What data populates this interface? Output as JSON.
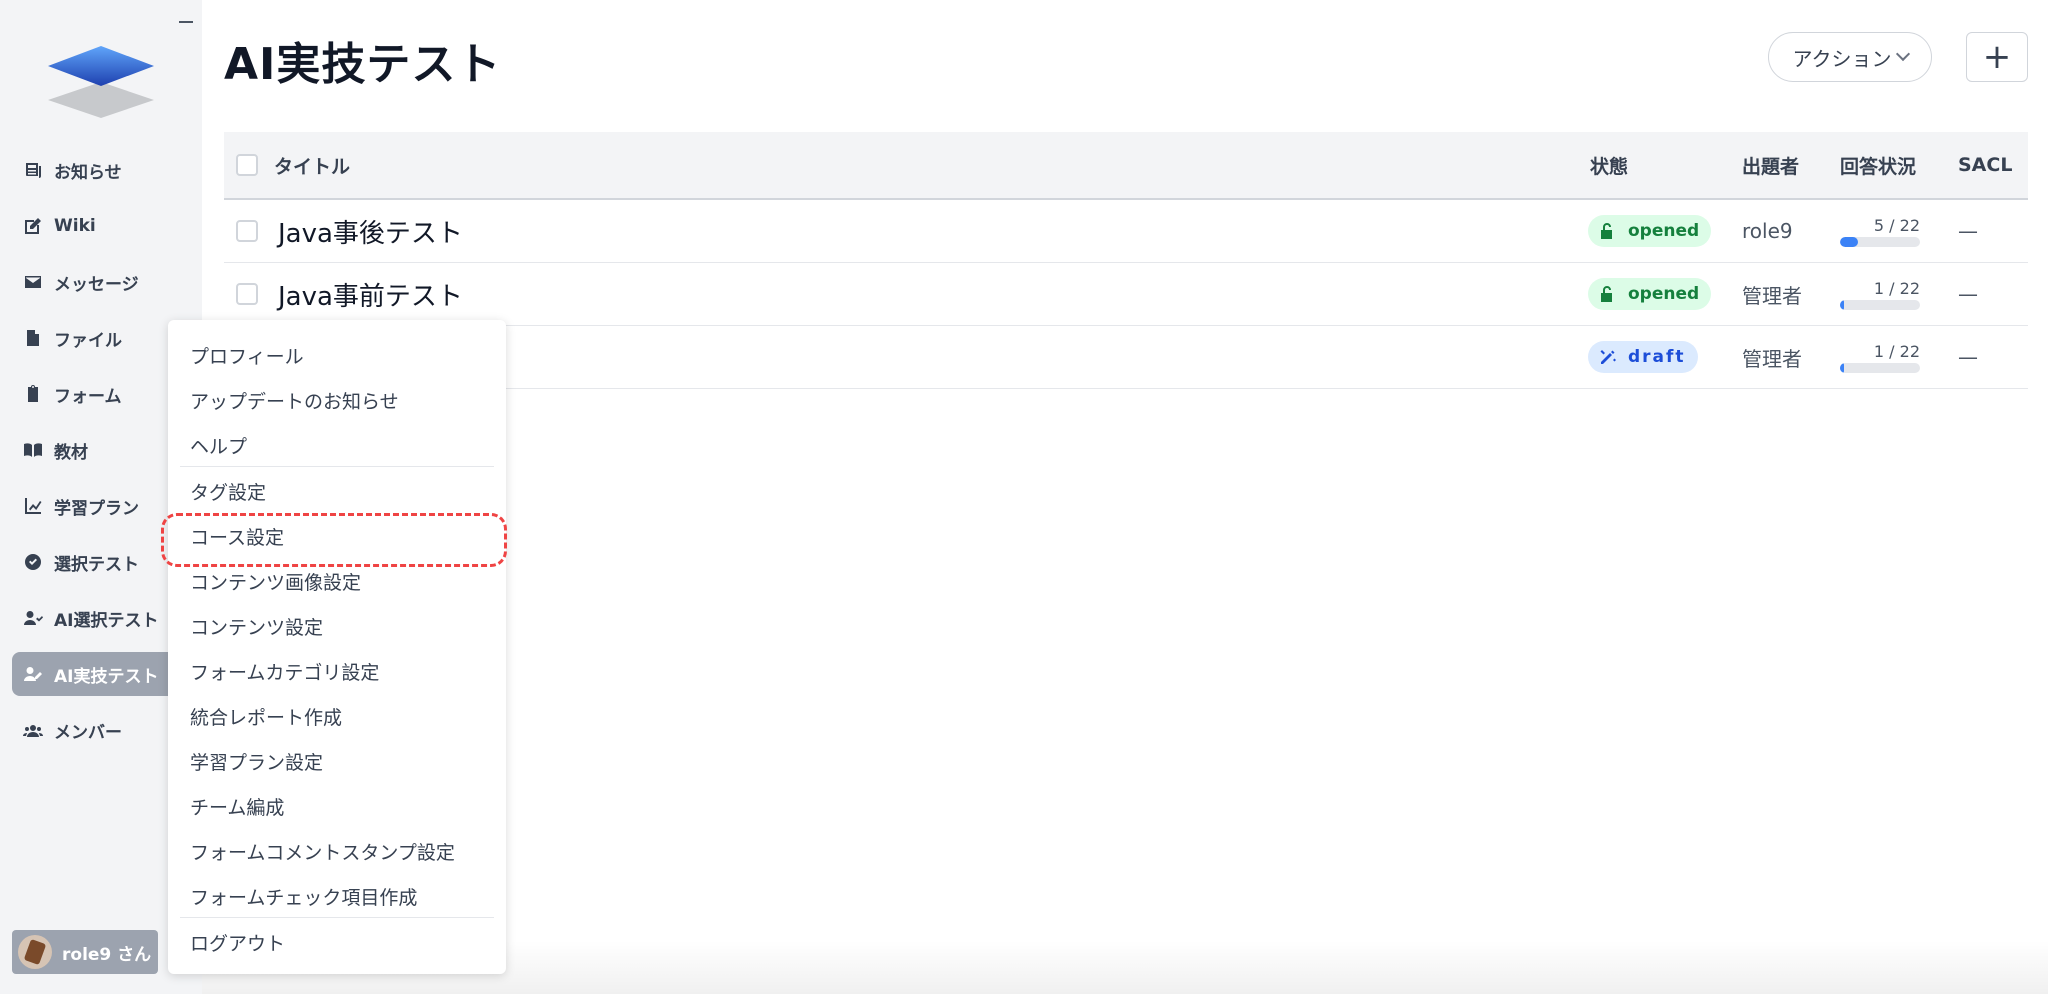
{
  "sidebar": {
    "items": [
      {
        "label": "お知らせ",
        "icon": "newspaper-icon",
        "active": false
      },
      {
        "label": "Wiki",
        "icon": "edit-icon",
        "active": false
      },
      {
        "label": "メッセージ",
        "icon": "envelope-icon",
        "active": false
      },
      {
        "label": "ファイル",
        "icon": "file-icon",
        "active": false
      },
      {
        "label": "フォーム",
        "icon": "clipboard-icon",
        "active": false
      },
      {
        "label": "教材",
        "icon": "book-icon",
        "active": false
      },
      {
        "label": "学習プラン",
        "icon": "chart-line-icon",
        "active": false
      },
      {
        "label": "選択テスト",
        "icon": "check-circle-icon",
        "active": false
      },
      {
        "label": "AI選択テスト",
        "icon": "user-check-icon",
        "active": false
      },
      {
        "label": "AI実技テスト",
        "icon": "user-pen-icon",
        "active": true
      },
      {
        "label": "メンバー",
        "icon": "users-icon",
        "active": false
      }
    ],
    "user": {
      "name": "role9 さん"
    }
  },
  "header": {
    "title": "AI実技テスト",
    "action_label": "アクション",
    "add_label": "+"
  },
  "table": {
    "columns": [
      "タイトル",
      "状態",
      "出題者",
      "回答状況",
      "SACL"
    ],
    "rows": [
      {
        "title": "Java事後テスト",
        "status": "opened",
        "author": "role9",
        "progress_text": "5 / 22",
        "progress": 0.227,
        "sacl": "—"
      },
      {
        "title": "Java事前テスト",
        "status": "opened",
        "author": "管理者",
        "progress_text": "1 / 22",
        "progress": 0.045,
        "sacl": "—"
      },
      {
        "title": "",
        "status": "draft",
        "author": "管理者",
        "progress_text": "1 / 22",
        "progress": 0.045,
        "sacl": "—"
      }
    ]
  },
  "menu": {
    "items": [
      "プロフィール",
      "アップデートのお知らせ",
      "ヘルプ",
      "タグ設定",
      "コース設定",
      "コンテンツ画像設定",
      "コンテンツ設定",
      "フォームカテゴリ設定",
      "統合レポート作成",
      "学習プラン設定",
      "チーム編成",
      "フォームコメントスタンプ設定",
      "フォームチェック項目作成",
      "ログアウト"
    ],
    "highlighted": "コース設定"
  },
  "colors": {
    "active_nav": "#9ca3af",
    "opened_badge_bg": "#dcfce7",
    "opened_badge_text": "#15803d",
    "draft_badge_bg": "#dbeafe",
    "draft_badge_text": "#1d4ed8",
    "progress": "#3b82f6",
    "highlight": "#ef4444"
  }
}
